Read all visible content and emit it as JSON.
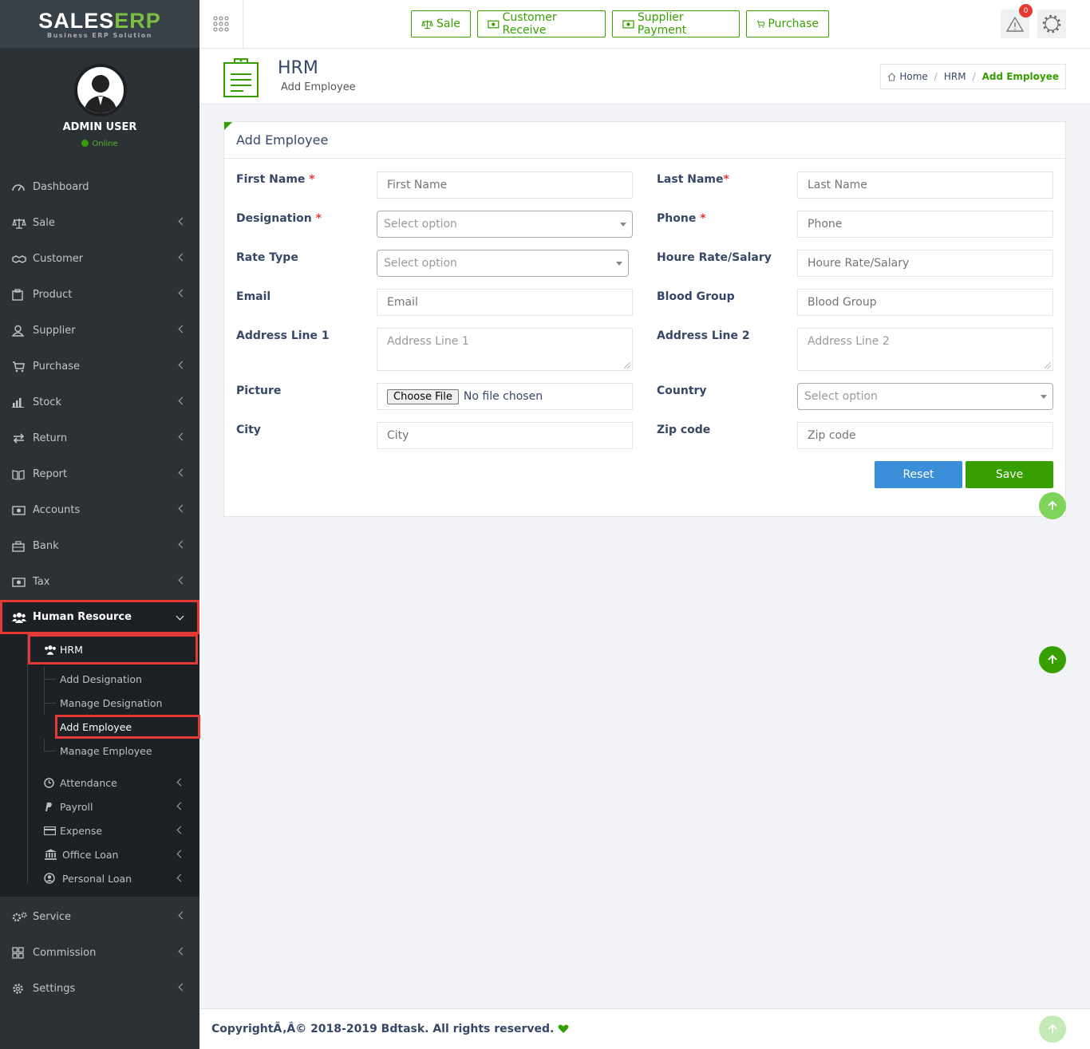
{
  "brand": {
    "logo_main": "SALES",
    "logo_accent": "ERP",
    "logo_sub": "Business ERP Solution"
  },
  "user": {
    "name": "ADMIN USER",
    "status": "Online"
  },
  "sidebar": {
    "items": [
      {
        "label": "Dashboard"
      },
      {
        "label": "Sale"
      },
      {
        "label": "Customer"
      },
      {
        "label": "Product"
      },
      {
        "label": "Supplier"
      },
      {
        "label": "Purchase"
      },
      {
        "label": "Stock"
      },
      {
        "label": "Return"
      },
      {
        "label": "Report"
      },
      {
        "label": "Accounts"
      },
      {
        "label": "Bank"
      },
      {
        "label": "Tax"
      }
    ],
    "active": {
      "label": "Human Resource"
    },
    "hrm": {
      "label": "HRM"
    },
    "hrm_items": [
      {
        "label": "Add Designation"
      },
      {
        "label": "Manage Designation"
      },
      {
        "label": "Add Employee"
      },
      {
        "label": "Manage Employee"
      }
    ],
    "hr_subs": [
      {
        "label": "Attendance"
      },
      {
        "label": "Payroll"
      },
      {
        "label": "Expense"
      },
      {
        "label": "Office Loan"
      },
      {
        "label": "Personal Loan"
      }
    ],
    "bottom": [
      {
        "label": "Service"
      },
      {
        "label": "Commission"
      },
      {
        "label": "Settings"
      }
    ]
  },
  "topbar": {
    "sale": "Sale",
    "customer_receive": "Customer Receive",
    "supplier_payment": "Supplier Payment",
    "purchase": "Purchase",
    "notification_count": "0"
  },
  "header": {
    "title": "HRM",
    "subtitle": "Add Employee",
    "breadcrumb": {
      "home": "Home",
      "section": "HRM",
      "current": "Add Employee"
    }
  },
  "form": {
    "title": "Add Employee",
    "first_name": {
      "label": "First Name",
      "placeholder": "First Name"
    },
    "last_name": {
      "label": "Last Name",
      "placeholder": "Last Name"
    },
    "designation": {
      "label": "Designation",
      "value": "Select option"
    },
    "phone": {
      "label": "Phone",
      "placeholder": "Phone"
    },
    "rate_type": {
      "label": "Rate Type",
      "value": "Select option"
    },
    "hourly_rate": {
      "label": "Houre Rate/Salary",
      "placeholder": "Houre Rate/Salary"
    },
    "email": {
      "label": "Email",
      "placeholder": "Email"
    },
    "blood_group": {
      "label": "Blood Group",
      "placeholder": "Blood Group"
    },
    "address1": {
      "label": "Address Line 1",
      "placeholder": "Address Line 1"
    },
    "address2": {
      "label": "Address Line 2",
      "placeholder": "Address Line 2"
    },
    "picture": {
      "label": "Picture",
      "button": "Choose File",
      "status": "No file chosen"
    },
    "country": {
      "label": "Country",
      "value": "Select option"
    },
    "city": {
      "label": "City",
      "placeholder": "City"
    },
    "zip": {
      "label": "Zip code",
      "placeholder": "Zip code"
    },
    "required_mark": "*",
    "reset": "Reset",
    "save": "Save"
  },
  "footer": {
    "text": "CopyrightÃ‚Â© 2018-2019 Bdtask. All rights reserved."
  },
  "colors": {
    "accent": "#37a000",
    "sidebar": "#2c3136",
    "reset": "#3a8fd8",
    "highlight": "#e53935"
  }
}
